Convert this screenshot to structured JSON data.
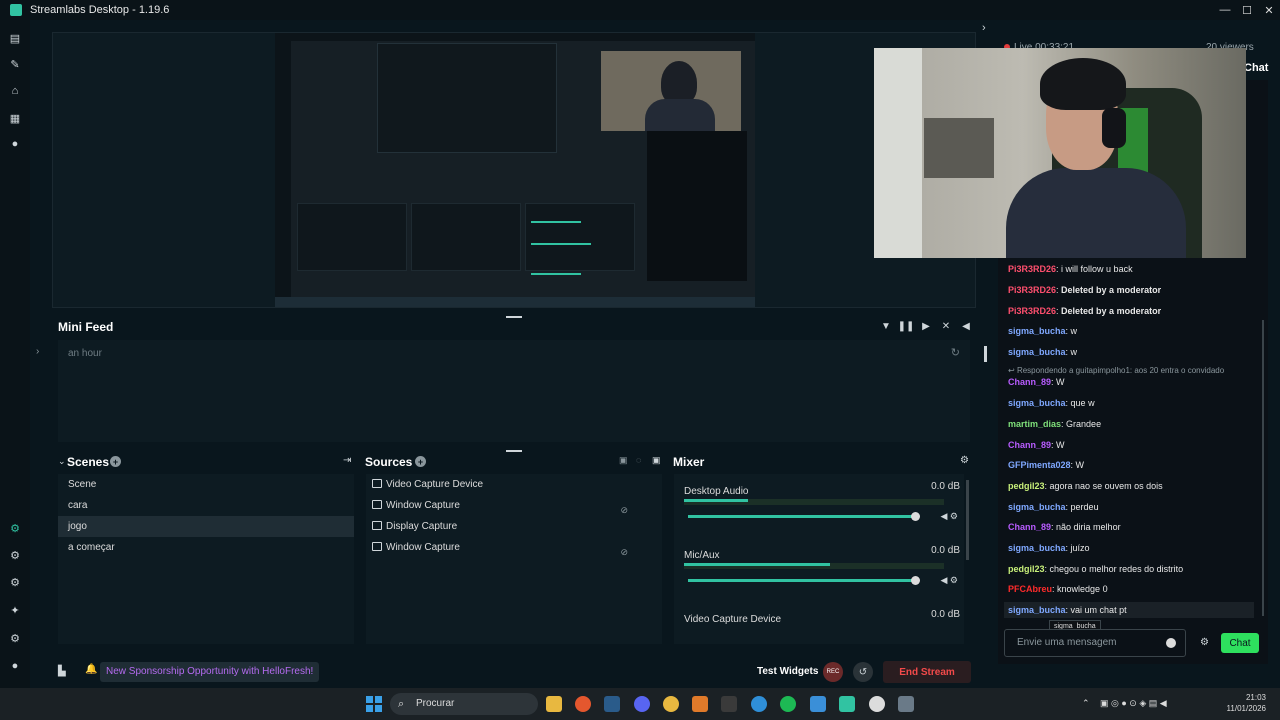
{
  "window": {
    "title": "Streamlabs Desktop - 1.19.6",
    "minimize": "—",
    "maximize": "☐",
    "close": "✕"
  },
  "stream": {
    "live": "Live 00:33:21",
    "viewers": "20 viewers",
    "chat_tab": "Chat"
  },
  "minifeed": {
    "title": "Mini Feed",
    "time": "an hour"
  },
  "scenes": {
    "title": "Scenes",
    "items": [
      "Scene",
      "cara",
      "jogo",
      "a começar"
    ],
    "active_index": 2
  },
  "sources": {
    "title": "Sources",
    "items": [
      "Video Capture Device",
      "Window Capture",
      "Display Capture",
      "Window Capture"
    ]
  },
  "mixer": {
    "title": "Mixer",
    "items": [
      {
        "name": "Desktop Audio",
        "db": "0.0 dB",
        "level": 0.25
      },
      {
        "name": "Mic/Aux",
        "db": "0.0 dB",
        "level": 0.55
      },
      {
        "name": "Video Capture Device",
        "db": "0.0 dB",
        "level": 0.0
      }
    ]
  },
  "footer": {
    "sponsor": "New Sponsorship Opportunity with HelloFresh!",
    "test_widgets": "Test Widgets",
    "rec": "REC",
    "end_stream": "End Stream"
  },
  "chat": {
    "reply_ref": "Respondendo a guitapimpolho1: aos 20 entra o convidado",
    "messages": [
      {
        "user": "Pi3R3RD26",
        "text": "i will follow u back",
        "color": "#ff4f6e"
      },
      {
        "user": "Pi3R3RD26",
        "text": "Deleted by a moderator",
        "color": "#ff4f6e",
        "deleted": true
      },
      {
        "user": "Pi3R3RD26",
        "text": "Deleted by a moderator",
        "color": "#ff4f6e",
        "deleted": true
      },
      {
        "user": "sigma_bucha",
        "text": "w",
        "color": "#7fa8ff"
      },
      {
        "user": "sigma_bucha",
        "text": "w",
        "color": "#7fa8ff"
      },
      {
        "user": "Chann_89",
        "text": "W",
        "color": "#b85cff"
      },
      {
        "user": "sigma_bucha",
        "text": "que w",
        "color": "#7fa8ff"
      },
      {
        "user": "martim_dias",
        "text": "Grandee",
        "color": "#7fe07a"
      },
      {
        "user": "Chann_89",
        "text": "W",
        "color": "#b85cff"
      },
      {
        "user": "GFPimenta028",
        "text": "W",
        "color": "#7fa8ff"
      },
      {
        "user": "pedgil23",
        "text": "agora nao se ouvem os dois",
        "color": "#c8f07a"
      },
      {
        "user": "sigma_bucha",
        "text": "perdeu",
        "color": "#7fa8ff"
      },
      {
        "user": "Chann_89",
        "text": "não diria melhor",
        "color": "#b85cff"
      },
      {
        "user": "sigma_bucha",
        "text": "juízo",
        "color": "#7fa8ff"
      },
      {
        "user": "pedgil23",
        "text": "chegou o melhor redes do distrito",
        "color": "#c8f07a"
      },
      {
        "user": "PFCAbreu",
        "text": "knowledge 0",
        "color": "#ff2b2b"
      },
      {
        "user": "sigma_bucha",
        "text": "vai um chat pt",
        "color": "#7fa8ff"
      }
    ],
    "tooltip": "sigma_bucha",
    "placeholder": "Envie uma mensagem",
    "send": "Chat"
  },
  "taskbar": {
    "search": "Procurar",
    "time": "21:03",
    "date": "11/01/2026"
  }
}
